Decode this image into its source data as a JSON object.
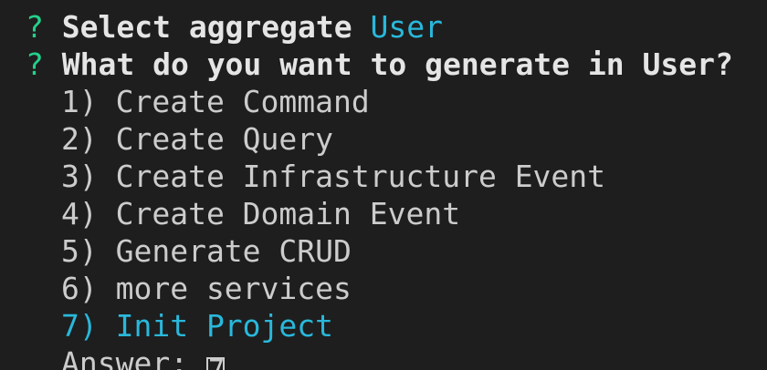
{
  "terminal": {
    "prompts": [
      {
        "marker": "?",
        "question": "Select aggregate",
        "answer": "User"
      },
      {
        "marker": "?",
        "question": "What do you want to generate in User?",
        "answer": ""
      }
    ],
    "options": [
      {
        "label": "1) Create Command",
        "selected": false
      },
      {
        "label": "2) Create Query",
        "selected": false
      },
      {
        "label": "3) Create Infrastructure Event",
        "selected": false
      },
      {
        "label": "4) Create Domain Event",
        "selected": false
      },
      {
        "label": "5) Generate CRUD",
        "selected": false
      },
      {
        "label": "6) more services",
        "selected": false
      },
      {
        "label": "7) Init Project",
        "selected": true
      }
    ],
    "answer_label": "Answer:",
    "answer_value": "7"
  },
  "colors": {
    "background": "#1e1e1e",
    "prompt_marker": "#23d18b",
    "highlight": "#29b8db",
    "text": "#cccccc"
  }
}
